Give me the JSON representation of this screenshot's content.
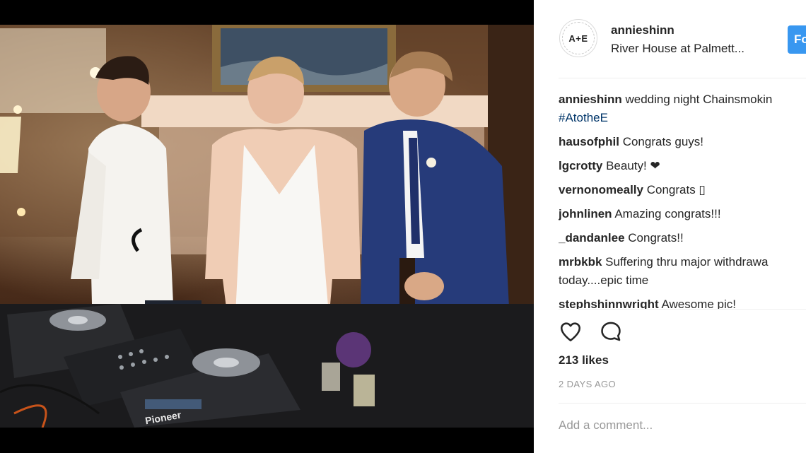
{
  "post": {
    "username": "annieshinn",
    "location": "River House at Palmett...",
    "follow_label": "Fo",
    "avatar_text": "A+E"
  },
  "photo": {
    "alt": "Wedding night DJ photo",
    "mixer_brand": "Pioneer",
    "deck_brand": "Pioneer"
  },
  "comments": [
    {
      "user": "annieshinn",
      "text": "wedding night Chainsmokin",
      "hashtag": "#AtotheE"
    },
    {
      "user": "hausofphil",
      "text": "Congrats guys!"
    },
    {
      "user": "lgcrotty",
      "text": "Beauty! ❤"
    },
    {
      "user": "vernonomeally",
      "text": "Congrats ▯"
    },
    {
      "user": "johnlinen",
      "text": "Amazing congrats!!!"
    },
    {
      "user": "_dandanlee",
      "text": "Congrats!!"
    },
    {
      "user": "mrbkbk",
      "text": "Suffering thru major withdrawa",
      "text2": "today....epic time"
    },
    {
      "user": "stephshinnwright",
      "text": "Awesome pic!"
    }
  ],
  "actions": {
    "like_icon": "heart-outline-icon",
    "comment_icon": "speech-bubble-icon"
  },
  "likes": "213 likes",
  "timestamp": "2 DAYS AGO",
  "add_comment_placeholder": "Add a comment...",
  "colors": {
    "follow_button": "#3897f0",
    "hashtag": "#003569",
    "muted": "#999999",
    "divider": "#efefef"
  }
}
